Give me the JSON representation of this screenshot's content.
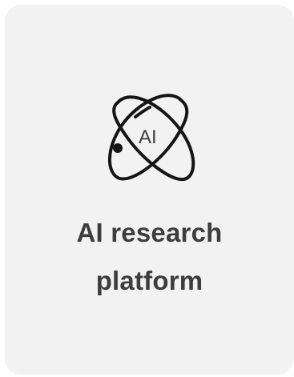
{
  "card": {
    "logo_icon": "atom-ai-icon",
    "logo_text": "AI",
    "title_line1": "AI research",
    "title_line2": "platform"
  },
  "colors": {
    "card_background": "#f2f2f2",
    "text": "#3d3d3d",
    "icon_stroke": "#151515"
  }
}
